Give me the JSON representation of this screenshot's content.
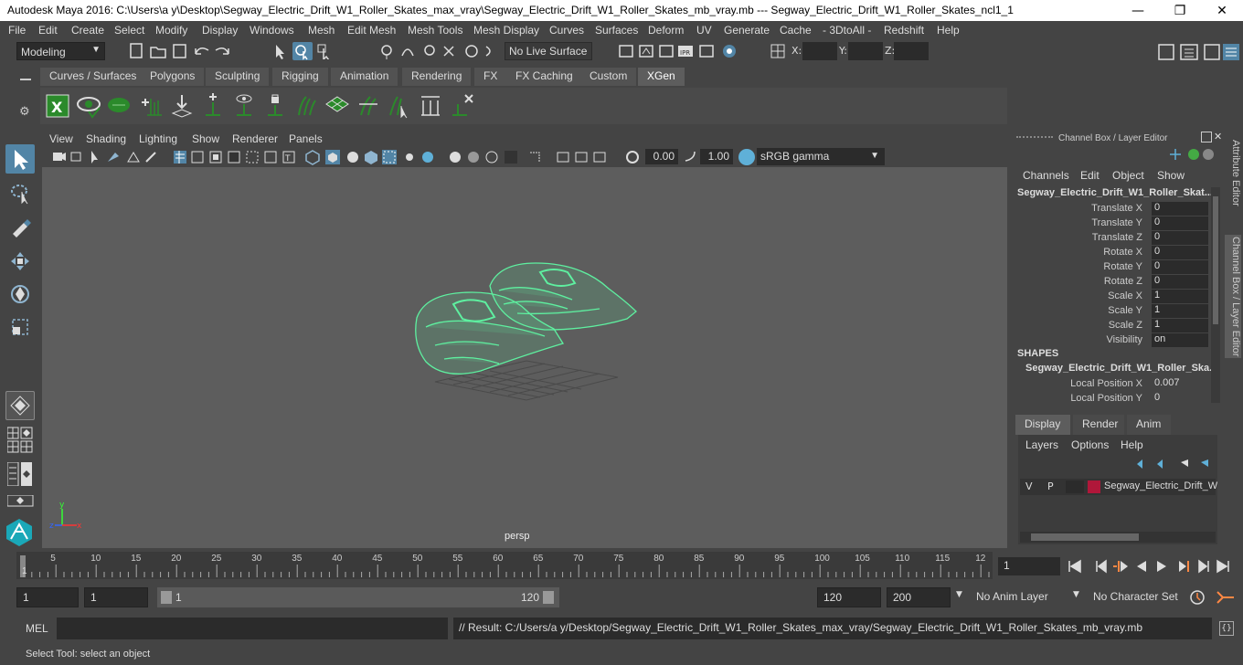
{
  "window": {
    "title": "Autodesk Maya 2016: C:\\Users\\a y\\Desktop\\Segway_Electric_Drift_W1_Roller_Skates_max_vray\\Segway_Electric_Drift_W1_Roller_Skates_mb_vray.mb   ---   Segway_Electric_Drift_W1_Roller_Skates_ncl1_1",
    "minimize": "—",
    "maximize": "❐",
    "close": "✕"
  },
  "menus": [
    "File",
    "Edit",
    "Create",
    "Select",
    "Modify",
    "Display",
    "Windows",
    "Mesh",
    "Edit Mesh",
    "Mesh Tools",
    "Mesh Display",
    "Curves",
    "Surfaces",
    "Deform",
    "UV",
    "Generate",
    "Cache",
    "- 3DtoAll -",
    "Redshift",
    "Help"
  ],
  "status": {
    "mode": "Modeling",
    "live_surface": "No Live Surface",
    "x_label": "X:",
    "y_label": "Y:",
    "z_label": "Z:"
  },
  "shelf_tabs": [
    "Curves / Surfaces",
    "Polygons",
    "Sculpting",
    "Rigging",
    "Animation",
    "Rendering",
    "FX",
    "FX Caching",
    "Custom",
    "XGen"
  ],
  "shelf_active": "XGen",
  "viewport": {
    "menus": [
      "View",
      "Shading",
      "Lighting",
      "Show",
      "Renderer",
      "Panels"
    ],
    "exposure": "0.00",
    "gamma": "1.00",
    "colorspace": "sRGB gamma",
    "camera_label": "persp"
  },
  "channel_box": {
    "title": "Channel Box / Layer Editor",
    "menus": [
      "Channels",
      "Edit",
      "Object",
      "Show"
    ],
    "object_name": "Segway_Electric_Drift_W1_Roller_Skat...",
    "channels": [
      {
        "name": "Translate X",
        "value": "0"
      },
      {
        "name": "Translate Y",
        "value": "0"
      },
      {
        "name": "Translate Z",
        "value": "0"
      },
      {
        "name": "Rotate X",
        "value": "0"
      },
      {
        "name": "Rotate Y",
        "value": "0"
      },
      {
        "name": "Rotate Z",
        "value": "0"
      },
      {
        "name": "Scale X",
        "value": "1"
      },
      {
        "name": "Scale Y",
        "value": "1"
      },
      {
        "name": "Scale Z",
        "value": "1"
      },
      {
        "name": "Visibility",
        "value": "on"
      }
    ],
    "shapes_header": "SHAPES",
    "shape_name": "Segway_Electric_Drift_W1_Roller_Ska...",
    "shape_channels": [
      {
        "name": "Local Position X",
        "value": "0.007"
      },
      {
        "name": "Local Position Y",
        "value": "0"
      }
    ]
  },
  "layer_editor": {
    "tabs": [
      "Display",
      "Render",
      "Anim"
    ],
    "menus": [
      "Layers",
      "Options",
      "Help"
    ],
    "layer": {
      "v": "V",
      "p": "P",
      "name": "Segway_Electric_Drift_W",
      "color": "#b0173a"
    }
  },
  "side_tabs": [
    "Attribute Editor",
    "Channel Box / Layer Editor"
  ],
  "timeline": {
    "ticks": [
      "5",
      "10",
      "15",
      "20",
      "25",
      "30",
      "35",
      "40",
      "45",
      "50",
      "55",
      "60",
      "65",
      "70",
      "75",
      "80",
      "85",
      "90",
      "95",
      "100",
      "105",
      "110",
      "115",
      "12"
    ],
    "current_marker": "1",
    "current_frame": "1"
  },
  "range": {
    "start_a": "1",
    "start_b": "1",
    "slider_start": "1",
    "slider_end": "120",
    "end_a": "120",
    "end_b": "200",
    "anim_layer": "No Anim Layer",
    "char_set": "No Character Set"
  },
  "command": {
    "lang": "MEL",
    "result": "// Result: C:/Users/a y/Desktop/Segway_Electric_Drift_W1_Roller_Skates_max_vray/Segway_Electric_Drift_W1_Roller_Skates_mb_vray.mb"
  },
  "help_line": "Select Tool: select an object",
  "colors": {
    "accent": "#5285a6",
    "wire": "#5ef0a0",
    "xgen": "#2b8a2b"
  }
}
